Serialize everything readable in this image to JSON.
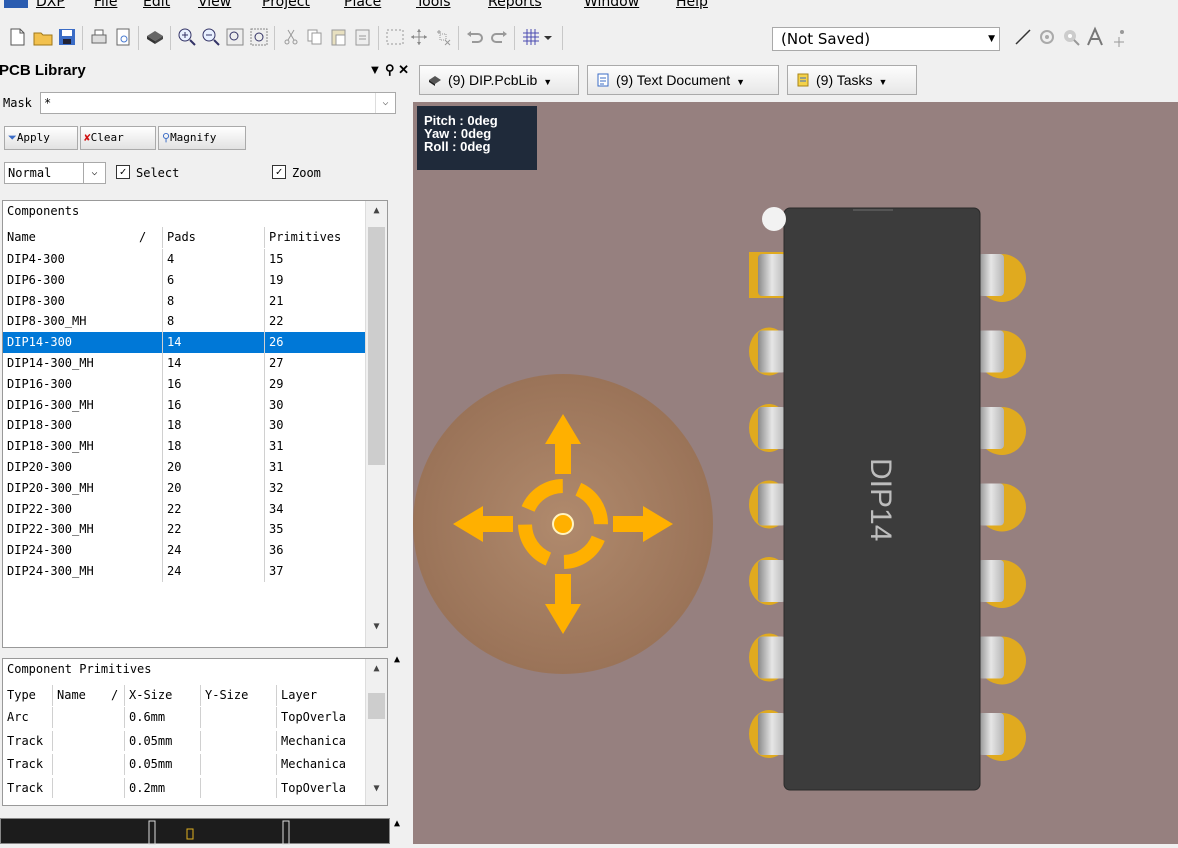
{
  "menu": [
    "DXP",
    "File",
    "Edit",
    "View",
    "Project",
    "Place",
    "Tools",
    "Reports",
    "Window",
    "Help"
  ],
  "toolbar": {
    "document_state": "(Not Saved)"
  },
  "panel": {
    "title": "PCB Library",
    "mask_label": "Mask",
    "mask_value": "*",
    "apply_label": "Apply",
    "clear_label": "Clear",
    "magnify_label": "Magnify",
    "mode_value": "Normal",
    "select_label": "Select",
    "zoom_label": "Zoom",
    "select_checked": true,
    "zoom_checked": true
  },
  "components": {
    "title": "Components",
    "headers": [
      "Name",
      "Pads",
      "Primitives"
    ],
    "sort_marker": "/",
    "rows": [
      [
        "DIP4-300",
        "4",
        "15"
      ],
      [
        "DIP6-300",
        "6",
        "19"
      ],
      [
        "DIP8-300",
        "8",
        "21"
      ],
      [
        "DIP8-300_MH",
        "8",
        "22"
      ],
      [
        "DIP14-300",
        "14",
        "26"
      ],
      [
        "DIP14-300_MH",
        "14",
        "27"
      ],
      [
        "DIP16-300",
        "16",
        "29"
      ],
      [
        "DIP16-300_MH",
        "16",
        "30"
      ],
      [
        "DIP18-300",
        "18",
        "30"
      ],
      [
        "DIP18-300_MH",
        "18",
        "31"
      ],
      [
        "DIP20-300",
        "20",
        "31"
      ],
      [
        "DIP20-300_MH",
        "20",
        "32"
      ],
      [
        "DIP22-300",
        "22",
        "34"
      ],
      [
        "DIP22-300_MH",
        "22",
        "35"
      ],
      [
        "DIP24-300",
        "24",
        "36"
      ],
      [
        "DIP24-300_MH",
        "24",
        "37"
      ]
    ],
    "selected_index": 4
  },
  "primitives": {
    "title": "Component Primitives",
    "headers": [
      "Type",
      "Name",
      "X-Size",
      "Y-Size",
      "Layer"
    ],
    "sort_marker": "/",
    "rows": [
      [
        "Arc",
        "",
        "0.6mm",
        "",
        "TopOverla"
      ],
      [
        "Track",
        "",
        "0.05mm",
        "",
        "Mechanica"
      ],
      [
        "Track",
        "",
        "0.05mm",
        "",
        "Mechanica"
      ],
      [
        "Track",
        "",
        "0.2mm",
        "",
        "TopOverla"
      ]
    ]
  },
  "tabs": [
    {
      "label": "(9) DIP.PcbLib"
    },
    {
      "label": "(9) Text Document"
    },
    {
      "label": "(9) Tasks"
    }
  ],
  "orientation": {
    "pitch": "Pitch : 0deg",
    "yaw": "Yaw : 0deg",
    "roll": "Roll : 0deg"
  },
  "footprint": {
    "label": "DIP14",
    "pins_per_side": 7
  },
  "colors": {
    "board": "#96807f",
    "pad": "#e0aa1f",
    "body": "#3a3a3a",
    "selection": "#0078d7",
    "arrow": "#ffb000"
  }
}
